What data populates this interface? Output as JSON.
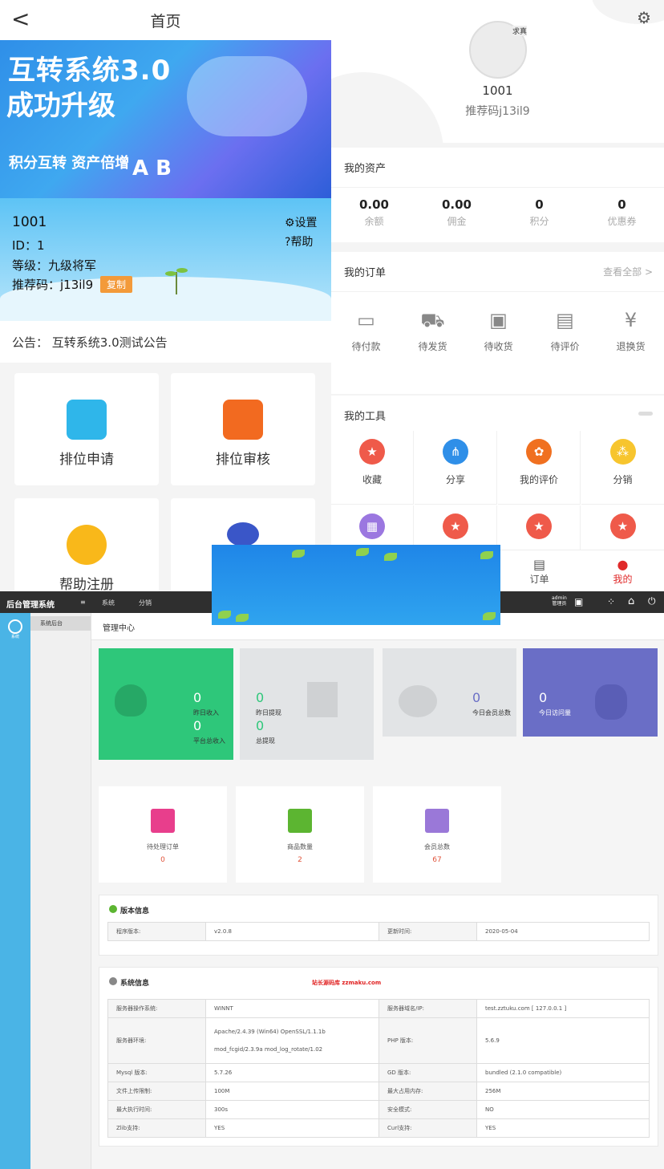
{
  "left_phone": {
    "header": {
      "title": "首页",
      "back": "<"
    },
    "banner": {
      "title1": "互转系统3.0",
      "title2": "成功升级",
      "slogan": "积分互转  资产倍增",
      "ab": "A B"
    },
    "user": {
      "name": "1001",
      "id": "ID：1",
      "level": "等级：九级将军",
      "ref": "推荐码：j13il9",
      "copy": "复制",
      "settings": "设置",
      "help": "帮助"
    },
    "notice": "公告：  互转系统3.0测试公告",
    "tiles": [
      {
        "label": "排位申请"
      },
      {
        "label": "排位审核"
      },
      {
        "label": "帮助注册"
      },
      {
        "label": ""
      }
    ]
  },
  "right_phone": {
    "user": {
      "name": "1001",
      "code": "推荐码j13il9",
      "avatar_text": "求真"
    },
    "assets": {
      "title": "我的资产",
      "items": [
        {
          "value": "0.00",
          "label": "余额"
        },
        {
          "value": "0.00",
          "label": "佣金"
        },
        {
          "value": "0",
          "label": "积分"
        },
        {
          "value": "0",
          "label": "优惠券"
        }
      ]
    },
    "orders": {
      "title": "我的订单",
      "view_all": "查看全部 >",
      "items": [
        {
          "label": "待付款"
        },
        {
          "label": "待发货"
        },
        {
          "label": "待收货"
        },
        {
          "label": "待评价"
        },
        {
          "label": "退换货"
        }
      ]
    },
    "tools": {
      "title": "我的工具",
      "items": [
        {
          "label": "收藏",
          "color": "#ef5a4a"
        },
        {
          "label": "分享",
          "color": "#2f8fe8"
        },
        {
          "label": "我的评价",
          "color": "#f07020"
        },
        {
          "label": "分销",
          "color": "#f7c52e"
        },
        {
          "label": "",
          "color": "#9b77e0"
        },
        {
          "label": "",
          "color": "#ef5a4a"
        },
        {
          "label": "",
          "color": "#ef5a4a"
        },
        {
          "label": "",
          "color": "#ef5a4a"
        }
      ]
    },
    "tabbar": [
      {
        "label": "订单",
        "icon": "order-icon"
      },
      {
        "label": "我的",
        "icon": "user-icon",
        "active": true
      }
    ]
  },
  "admin": {
    "brand": "后台管理系统",
    "menus": [
      "系统",
      "分销"
    ],
    "user": {
      "name": "admin",
      "role": "管理员"
    },
    "side_icon_label": "系统",
    "side_item": "系统后台",
    "breadcrumb": "管理中心",
    "stats": [
      {
        "v1": "0",
        "l1": "昨日收入",
        "v2": "0",
        "l2": "平台总收入",
        "color": "#2ec77a"
      },
      {
        "v1": "0",
        "l1": "昨日提现",
        "v2": "0",
        "l2": "总提现",
        "color": "#e2e4e6"
      },
      {
        "v1": "0",
        "l1": "今日会员总数",
        "color": "#e2e4e6"
      },
      {
        "v1": "0",
        "l1": "今日访问量",
        "color": "#6a6ec6"
      }
    ],
    "counts": [
      {
        "label": "待处理订单",
        "value": "0",
        "color": "#e83e8c"
      },
      {
        "label": "商品数量",
        "value": "2",
        "color": "#5cb531"
      },
      {
        "label": "会员总数",
        "value": "67",
        "color": "#9a78d8"
      }
    ],
    "version": {
      "title": "版本信息",
      "rows": [
        [
          "程序版本:",
          "v2.0.8",
          "更新时间:",
          "2020-05-04"
        ]
      ]
    },
    "sysinfo": {
      "title": "系统信息",
      "watermark": "站长源码库 zzmaku.com",
      "rows": [
        [
          "服务器操作系统:",
          "WINNT",
          "服务器域名/IP:",
          "test.zztuku.com [ 127.0.0.1 ]"
        ],
        [
          "服务器环境:",
          "Apache/2.4.39 (Win64) OpenSSL/1.1.1b mod_fcgid/2.3.9a mod_log_rotate/1.02",
          "PHP 版本:",
          "5.6.9"
        ],
        [
          "Mysql 版本:",
          "5.7.26",
          "GD 版本:",
          "bundled (2.1.0 compatible)"
        ],
        [
          "文件上传限制:",
          "100M",
          "最大占用内存:",
          "256M"
        ],
        [
          "最大执行时间:",
          "300s",
          "安全模式:",
          "NO"
        ],
        [
          "Zlib支持:",
          "YES",
          "Curl支持:",
          "YES"
        ]
      ]
    }
  }
}
